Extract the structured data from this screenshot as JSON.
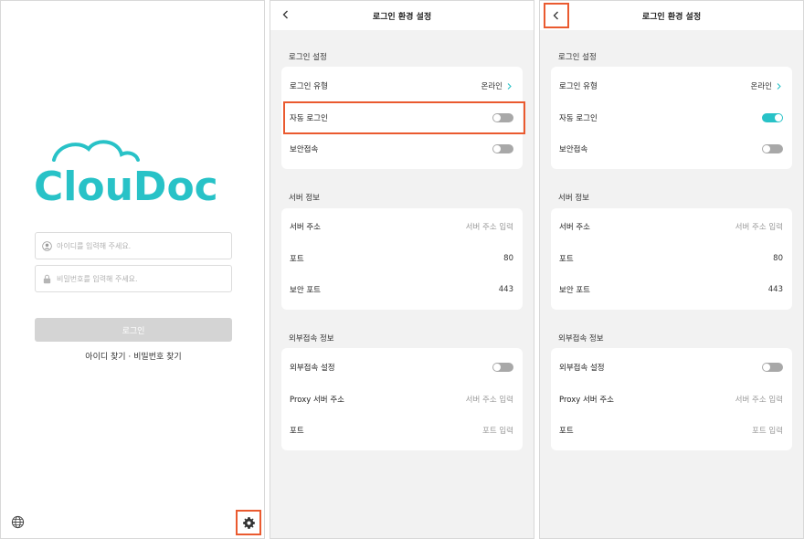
{
  "login": {
    "logo_text": "ClouDoc",
    "id_placeholder": "아이디를 입력해 주세요.",
    "pw_placeholder": "비밀번호를 입력해 주세요.",
    "login_button": "로그인",
    "find_links": "아이디 찾기 · 비밀번호 찾기",
    "globe_icon": "globe-icon",
    "gear_icon": "gear-icon",
    "brand_color": "#28c2c7",
    "highlight_color": "#ea5a2f"
  },
  "settings_a": {
    "title": "로그인 환경 설정",
    "login": {
      "section": "로그인 설정",
      "type_label": "로그인 유형",
      "type_value": "온라인",
      "auto_label": "자동 로그인",
      "auto_on": false,
      "secure_label": "보안접속",
      "secure_on": false
    },
    "server": {
      "section": "서버 정보",
      "address_label": "서버 주소",
      "address_placeholder": "서버 주소 입력",
      "port_label": "포트",
      "port_value": "80",
      "secure_port_label": "보안 포트",
      "secure_port_value": "443"
    },
    "external": {
      "section": "외부접속 정보",
      "setting_label": "외부접속 설정",
      "setting_on": false,
      "proxy_label": "Proxy 서버 주소",
      "proxy_placeholder": "서버 주소 입력",
      "port_label": "포트",
      "port_placeholder": "포트 입력"
    }
  },
  "settings_b": {
    "title": "로그인 환경 설정",
    "login": {
      "section": "로그인 설정",
      "type_label": "로그인 유형",
      "type_value": "온라인",
      "auto_label": "자동 로그인",
      "auto_on": true,
      "secure_label": "보안접속",
      "secure_on": false
    },
    "server": {
      "section": "서버 정보",
      "address_label": "서버 주소",
      "address_placeholder": "서버 주소 입력",
      "port_label": "포트",
      "port_value": "80",
      "secure_port_label": "보안 포트",
      "secure_port_value": "443"
    },
    "external": {
      "section": "외부접속 정보",
      "setting_label": "외부접속 설정",
      "setting_on": false,
      "proxy_label": "Proxy 서버 주소",
      "proxy_placeholder": "서버 주소 입력",
      "port_label": "포트",
      "port_placeholder": "포트 입력"
    }
  }
}
